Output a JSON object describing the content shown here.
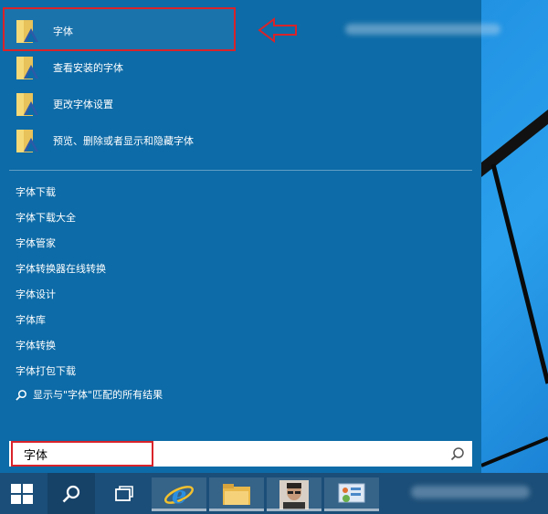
{
  "results": [
    {
      "label": "字体"
    },
    {
      "label": "查看安装的字体"
    },
    {
      "label": "更改字体设置"
    },
    {
      "label": "预览、删除或者显示和隐藏字体"
    }
  ],
  "suggestions": [
    "字体下载",
    "字体下载大全",
    "字体管家",
    "字体转换器在线转换",
    "字体设计",
    "字体库",
    "字体转换",
    "字体打包下载"
  ],
  "show_all": "显示与\"字体\"匹配的所有结果",
  "search": {
    "value": "字体"
  },
  "colors": {
    "panel": "#0d6ba7",
    "taskbar": "#1b4e78",
    "highlight": "#d9232a"
  }
}
